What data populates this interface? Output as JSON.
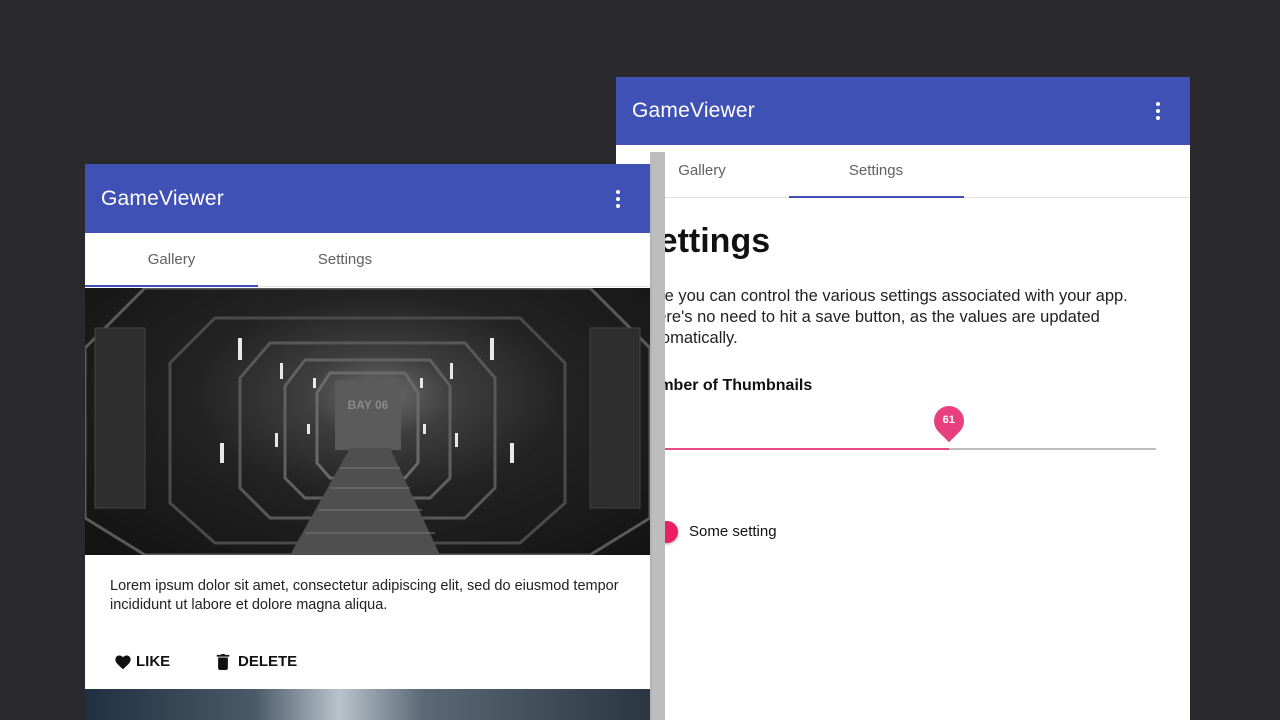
{
  "colors": {
    "app_bar": "#3f51b5",
    "accent": "#e91e63",
    "background": "#2a292e"
  },
  "right_window": {
    "app_title": "GameViewer",
    "menu_icon": "more-vert-icon",
    "tabs": [
      {
        "label": "Gallery",
        "selected": false
      },
      {
        "label": "Settings",
        "selected": true
      }
    ],
    "settings": {
      "heading": "Settings",
      "description": "Here you can control the various settings associated with your app. There's no need to hit a save button, as the values are updated automatically.",
      "slider": {
        "label": "Number of Thumbnails",
        "value": "61",
        "fraction": 0.6
      },
      "toggle": {
        "label": "Some setting",
        "on": true
      }
    }
  },
  "left_window": {
    "app_title": "GameViewer",
    "menu_icon": "more-vert-icon",
    "tabs": [
      {
        "label": "Gallery",
        "selected": true
      },
      {
        "label": "Settings",
        "selected": false
      }
    ],
    "card": {
      "image_label": "BAY 06",
      "text": "Lorem ipsum dolor sit amet, consectetur adipiscing elit, sed do eiusmod tempor incididunt ut labore et dolore magna aliqua.",
      "actions": [
        {
          "label": "LIKE",
          "icon": "heart-icon"
        },
        {
          "label": "DELETE",
          "icon": "trash-icon"
        }
      ]
    }
  }
}
